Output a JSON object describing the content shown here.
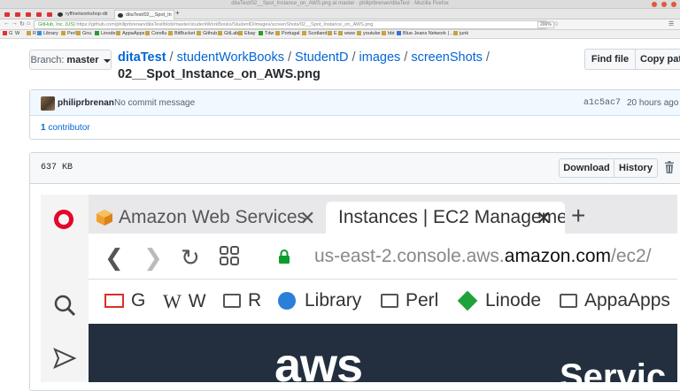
{
  "browser": {
    "window_title": "ditaTest/02__Spot_Instance_on_AWS.png at master · philiprbrenan/ditaTest · Mozilla Firefox",
    "tabs": [
      {
        "label": ""
      },
      {
        "label": ""
      },
      {
        "label": ""
      },
      {
        "label": ""
      },
      {
        "label": ""
      },
      {
        "label": "ryffine/workshop-dit"
      },
      {
        "label": "ditaTest/02__Spot_In"
      }
    ],
    "url_security": "GitHub, Inc. (US)",
    "url": "https://github.com/philiprbrenan/ditaTest/blob/master/studentWorkBooks/StudentD/images/screenShots/02__Spot_Instance_on_AWS.png",
    "zoom": "200%",
    "bookmarks": [
      "G",
      "W",
      "R",
      "Library",
      "Perl",
      "Gnu",
      "Linode",
      "AppaApps",
      "Corellu",
      "BitBucket",
      "Github",
      "GitLab",
      "Ebay",
      "Tdw",
      "Portugal",
      "Scotland",
      "E",
      "www",
      "youtube",
      "bbt",
      "Blue Jeans Network | ...",
      "junk"
    ]
  },
  "repo": {
    "branch_label": "Branch:",
    "branch": "master",
    "breadcrumb": [
      "ditaTest",
      "studentWorkBooks",
      "StudentD",
      "images",
      "screenShots"
    ],
    "separator": "/",
    "filename": "02__Spot_Instance_on_AWS.png",
    "find_file": "Find file",
    "copy_path": "Copy path"
  },
  "commit": {
    "author": "philiprbrenan",
    "message": "No commit message",
    "sha": "a1c5ac7",
    "time": "20 hours ago",
    "contributors_count": "1",
    "contributors_label": "contributor"
  },
  "file": {
    "size": "637 KB",
    "download": "Download",
    "history": "History"
  },
  "screenshot": {
    "tab1": "Amazon Web Services",
    "tab2": "Instances | EC2 Management",
    "url_prefix": "us-east-2.console.aws.",
    "url_domain": "amazon.com",
    "url_suffix": "/ec2/",
    "bookmarks": [
      "G",
      "W",
      "R",
      "Library",
      "Perl",
      "Linode",
      "AppaApps"
    ],
    "logo": "aws",
    "heading_fragment": "Servic"
  }
}
